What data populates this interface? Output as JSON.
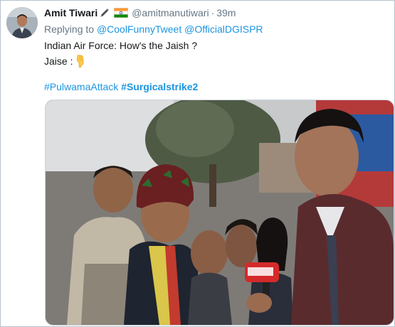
{
  "tweet": {
    "author_name": "Amit Tiwari",
    "author_handle": "@amitmanutiwari",
    "separator": "·",
    "time": "39m",
    "reply_prefix": "Replying to",
    "reply_mentions": [
      "@CoolFunnyTweet",
      "@OfficialDGISPR"
    ],
    "text_line1": "Indian Air Force: How's the Jaish ?",
    "text_line2": "Jaise :",
    "hashtags": [
      "#PulwamaAttack",
      "#Surgicalstrike2"
    ]
  },
  "icons": {
    "pen": "pen-icon",
    "flag": "india-flag-icon",
    "hand": "pointing-down-hand-emoji"
  },
  "colors": {
    "link": "#1b95e0",
    "secondary_text": "#657786",
    "primary_text": "#14171a",
    "border": "#b8c2cc"
  }
}
